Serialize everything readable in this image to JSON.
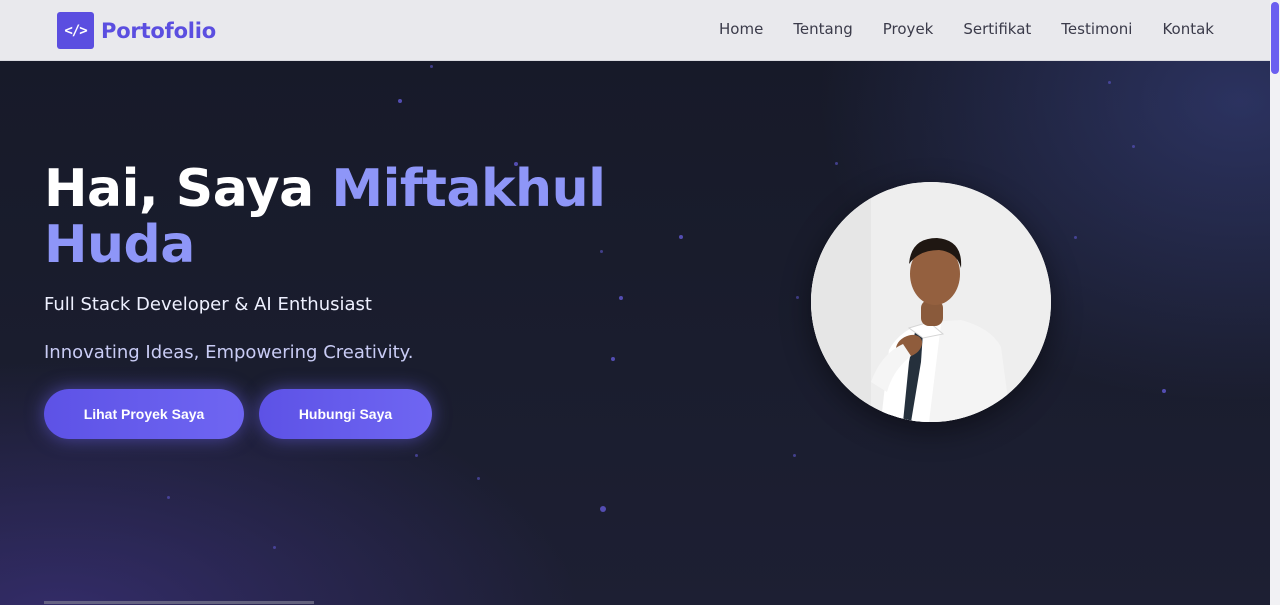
{
  "brand": {
    "icon_text": "</>",
    "icon_name": "code-icon",
    "name": "Portofolio",
    "color": "#5b4ee0"
  },
  "nav": {
    "items": [
      {
        "label": "Home"
      },
      {
        "label": "Tentang"
      },
      {
        "label": "Proyek"
      },
      {
        "label": "Sertifikat"
      },
      {
        "label": "Testimoni"
      },
      {
        "label": "Kontak"
      }
    ]
  },
  "hero": {
    "greeting": "Hai, Saya",
    "name_line1": "Miftakhul",
    "name_line2": "Huda",
    "subtitle": "Full Stack Developer & AI Enthusiast",
    "tagline": "Innovating Ideas, Empowering Creativity.",
    "primary_button": "Lihat Proyek Saya",
    "secondary_button": "Hubungi Saya",
    "accent_color": "#8e96f8"
  },
  "profile_photo": {
    "icon_name": "profile-photo"
  }
}
